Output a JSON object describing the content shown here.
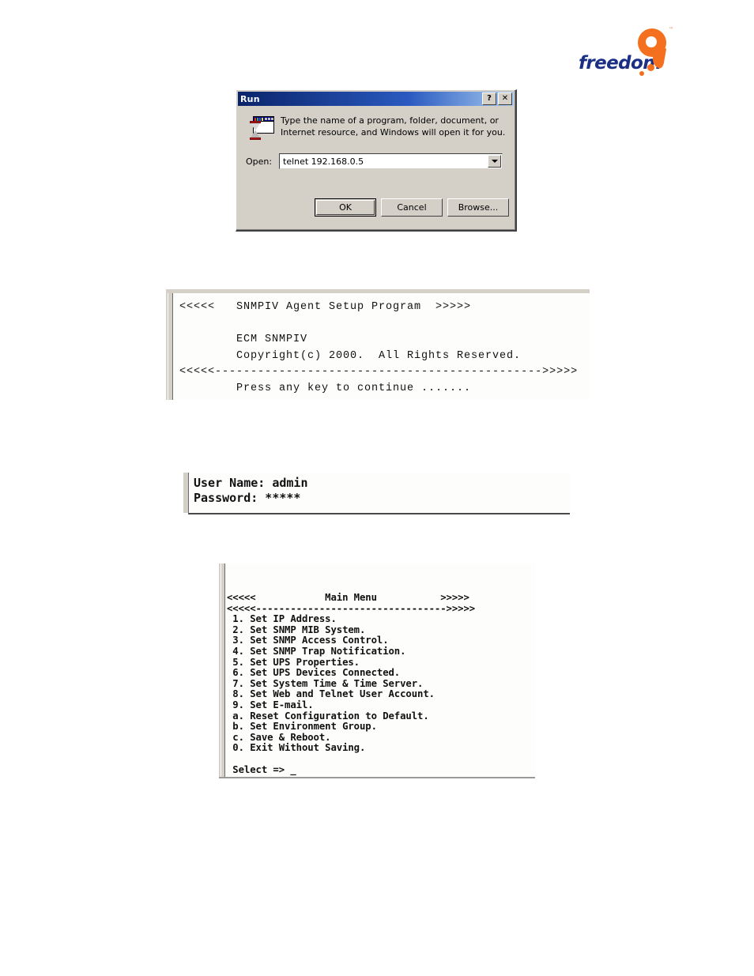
{
  "logo": {
    "word": "freedom",
    "numeral": "9",
    "tm": "™",
    "blue": "#1b2f85",
    "orange": "#f4701f"
  },
  "run_dialog": {
    "title": "Run",
    "help_button": "?",
    "close_button": "✕",
    "icon_name": "run-hourglass-window-icon",
    "description": "Type the name of a program, folder, document, or Internet resource, and Windows will open it for you.",
    "open_label": "Open:",
    "open_value": "telnet 192.168.0.5",
    "open_placeholder": "",
    "buttons": {
      "ok": "OK",
      "cancel": "Cancel",
      "browse": "Browse..."
    },
    "titlebar_gradient_start": "#0a246a",
    "titlebar_gradient_end": "#a6caf0",
    "face_color": "#d4d0c8"
  },
  "terminal_banner": {
    "text": "<<<<<   SNMPIV Agent Setup Program  >>>>>\n\n        ECM SNMPIV\n        Copyright(c) 2000.  All Rights Reserved.\n<<<<<---------------------------------------------->>>>>\n        Press any key to continue ......."
  },
  "terminal_login": {
    "text": "User Name: admin\nPassword: *****",
    "user_name_label": "User Name:",
    "user_name_value": "admin",
    "password_label": "Password:",
    "password_value": "*****"
  },
  "terminal_menu": {
    "header": "<<<<<            Main Menu           >>>>>",
    "divider": "<<<<<--------------------------------->>>>>",
    "items": [
      "1. Set IP Address.",
      "2. Set SNMP MIB System.",
      "3. Set SNMP Access Control.",
      "4. Set SNMP Trap Notification.",
      "5. Set UPS Properties.",
      "6. Set UPS Devices Connected.",
      "7. Set System Time & Time Server.",
      "8. Set Web and Telnet User Account.",
      "9. Set E-mail.",
      "a. Reset Configuration to Default.",
      "b. Set Environment Group.",
      "c. Save & Reboot.",
      "0. Exit Without Saving."
    ],
    "prompt": "Select => _",
    "text": "<<<<<            Main Menu           >>>>>\n<<<<<--------------------------------->>>>>\n 1. Set IP Address.\n 2. Set SNMP MIB System.\n 3. Set SNMP Access Control.\n 4. Set SNMP Trap Notification.\n 5. Set UPS Properties.\n 6. Set UPS Devices Connected.\n 7. Set System Time & Time Server.\n 8. Set Web and Telnet User Account.\n 9. Set E-mail.\n a. Reset Configuration to Default.\n b. Set Environment Group.\n c. Save & Reboot.\n 0. Exit Without Saving.\n\n Select => _"
  }
}
